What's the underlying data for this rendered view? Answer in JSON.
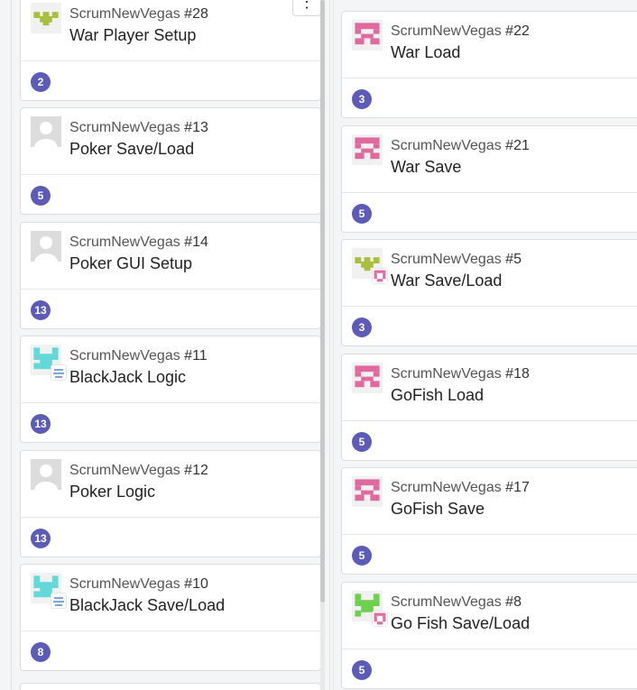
{
  "left_column": [
    {
      "project": "ScrumNewVegas",
      "number": "#28",
      "title": "War Player Setup",
      "weight": "2",
      "avatar": "olive-identicon"
    },
    {
      "project": "ScrumNewVegas",
      "number": "#13",
      "title": "Poker Save/Load",
      "weight": "5",
      "avatar": "default-user-icon"
    },
    {
      "project": "ScrumNewVegas",
      "number": "#14",
      "title": "Poker GUI Setup",
      "weight": "13",
      "avatar": "default-user-icon"
    },
    {
      "project": "ScrumNewVegas",
      "number": "#11",
      "title": "BlackJack Logic",
      "weight": "13",
      "avatar": "cyan-identicon"
    },
    {
      "project": "ScrumNewVegas",
      "number": "#12",
      "title": "Poker Logic",
      "weight": "13",
      "avatar": "default-user-icon"
    },
    {
      "project": "ScrumNewVegas",
      "number": "#10",
      "title": "BlackJack Save/Load",
      "weight": "8",
      "avatar": "cyan-identicon"
    }
  ],
  "right_column": [
    {
      "project": "ScrumNewVegas",
      "number": "#22",
      "title": "War Load",
      "weight": "3",
      "avatar": "pink-identicon"
    },
    {
      "project": "ScrumNewVegas",
      "number": "#21",
      "title": "War Save",
      "weight": "5",
      "avatar": "pink-identicon"
    },
    {
      "project": "ScrumNewVegas",
      "number": "#5",
      "title": "War Save/Load",
      "weight": "3",
      "avatar": "olive-identicon"
    },
    {
      "project": "ScrumNewVegas",
      "number": "#18",
      "title": "GoFish Load",
      "weight": "5",
      "avatar": "pink-identicon"
    },
    {
      "project": "ScrumNewVegas",
      "number": "#17",
      "title": "GoFish Save",
      "weight": "5",
      "avatar": "pink-identicon"
    },
    {
      "project": "ScrumNewVegas",
      "number": "#8",
      "title": "Go Fish Save/Load",
      "weight": "5",
      "avatar": "green-identicon"
    }
  ],
  "menu_icon": "more-vertical-icon",
  "colors": {
    "weight_badge": "#5c5cb8",
    "olive": "#a7bf3c",
    "cyan": "#62d8d8",
    "pink": "#e06aa0",
    "green": "#6fcf4f"
  }
}
